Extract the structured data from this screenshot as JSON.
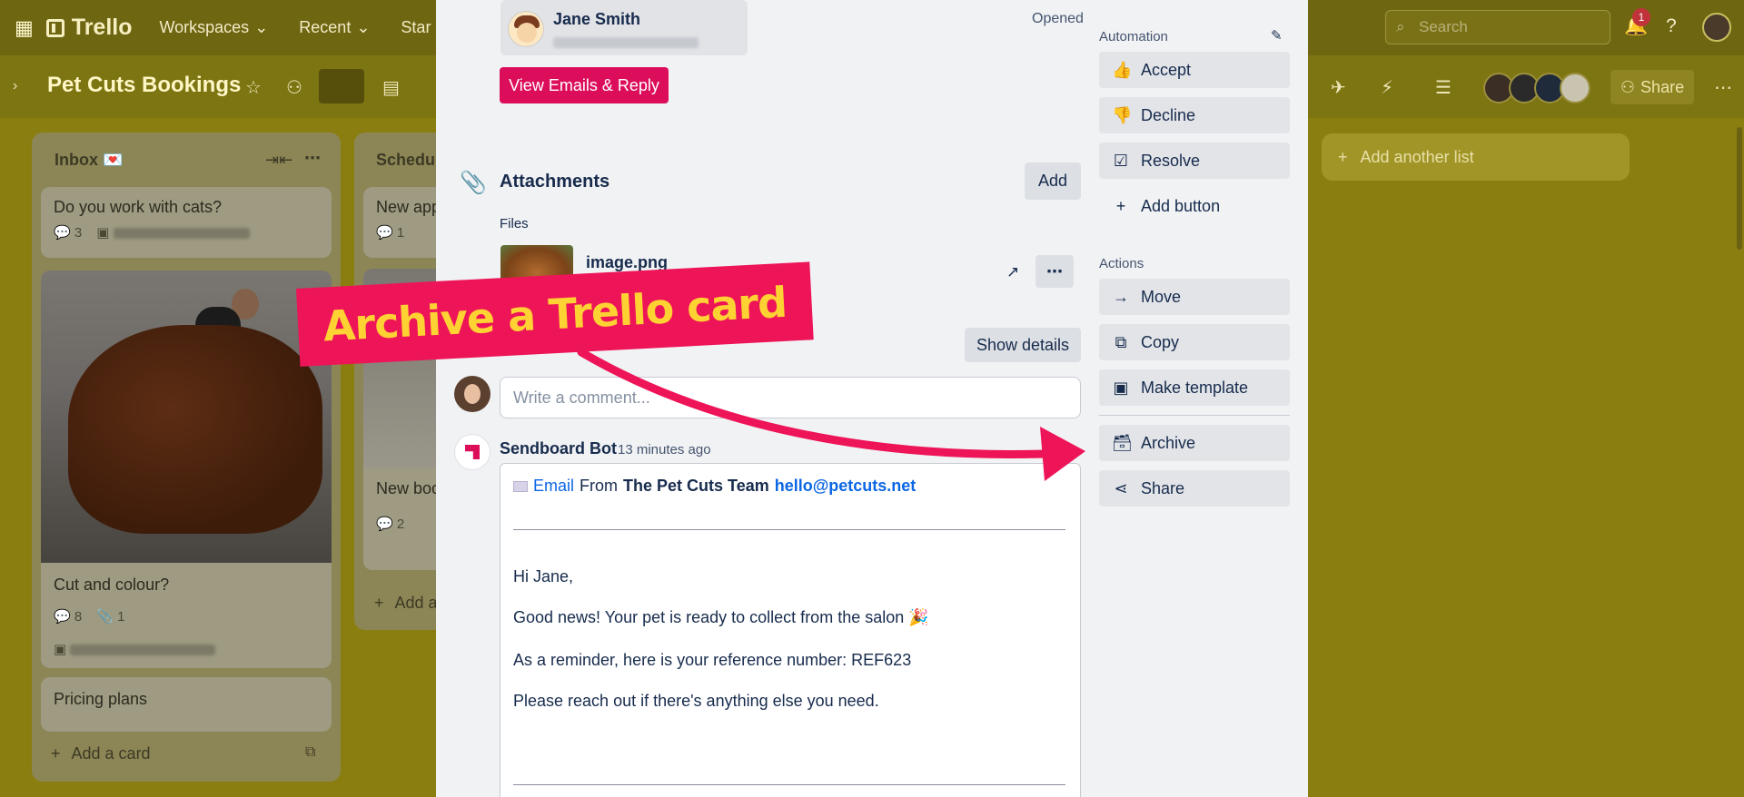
{
  "topbar": {
    "app_name": "Trello",
    "nav": [
      "Workspaces",
      "Recent",
      "Star"
    ],
    "search_placeholder": "Search",
    "notification_count": "1"
  },
  "board": {
    "title": "Pet Cuts Bookings",
    "share_label": "Share",
    "add_list_label": "Add another list"
  },
  "lists": [
    {
      "title": "Inbox 💌",
      "cards": [
        {
          "title": "Do you work with cats?",
          "comments": "3"
        },
        {
          "title": "Cut and colour?",
          "comments": "8",
          "attachments": "1"
        },
        {
          "title": "Pricing plans"
        }
      ],
      "add_card_label": "Add a card"
    },
    {
      "title": "Schedule",
      "cards": [
        {
          "title": "New app",
          "comments": "1"
        },
        {
          "title": "New boo",
          "comments": "2"
        }
      ],
      "add_card_label": "Add a"
    }
  ],
  "card_detail": {
    "contact_name": "Jane Smith",
    "status": "Opened",
    "view_emails_label": "View Emails & Reply",
    "attachments_title": "Attachments",
    "add_label": "Add",
    "files_label": "Files",
    "file_name": "image.png",
    "show_details_label": "Show details",
    "comment_placeholder": "Write a comment...",
    "activity": {
      "author": "Sendboard Bot",
      "time": "13 minutes ago",
      "email_label": "Email",
      "from_label": "From",
      "from_name": "The Pet Cuts Team",
      "from_email": "hello@petcuts.net",
      "lines": [
        "Hi Jane,",
        "Good news! Your pet is ready to collect from the salon 🎉",
        "As a reminder, here is your reference number: REF623",
        "Please reach out if there's anything else you need."
      ]
    }
  },
  "sidebar": {
    "automation_label": "Automation",
    "automation_buttons": [
      "Accept",
      "Decline",
      "Resolve",
      "Add button"
    ],
    "actions_label": "Actions",
    "action_buttons": [
      "Move",
      "Copy",
      "Make template",
      "Archive",
      "Share"
    ]
  },
  "overlay": {
    "banner_text": "Archive a Trello card",
    "banner_color": "#ee1458",
    "banner_text_color": "#ffd233"
  },
  "colors": {
    "accent": "#dc0e5c",
    "link": "#0c66e4"
  }
}
